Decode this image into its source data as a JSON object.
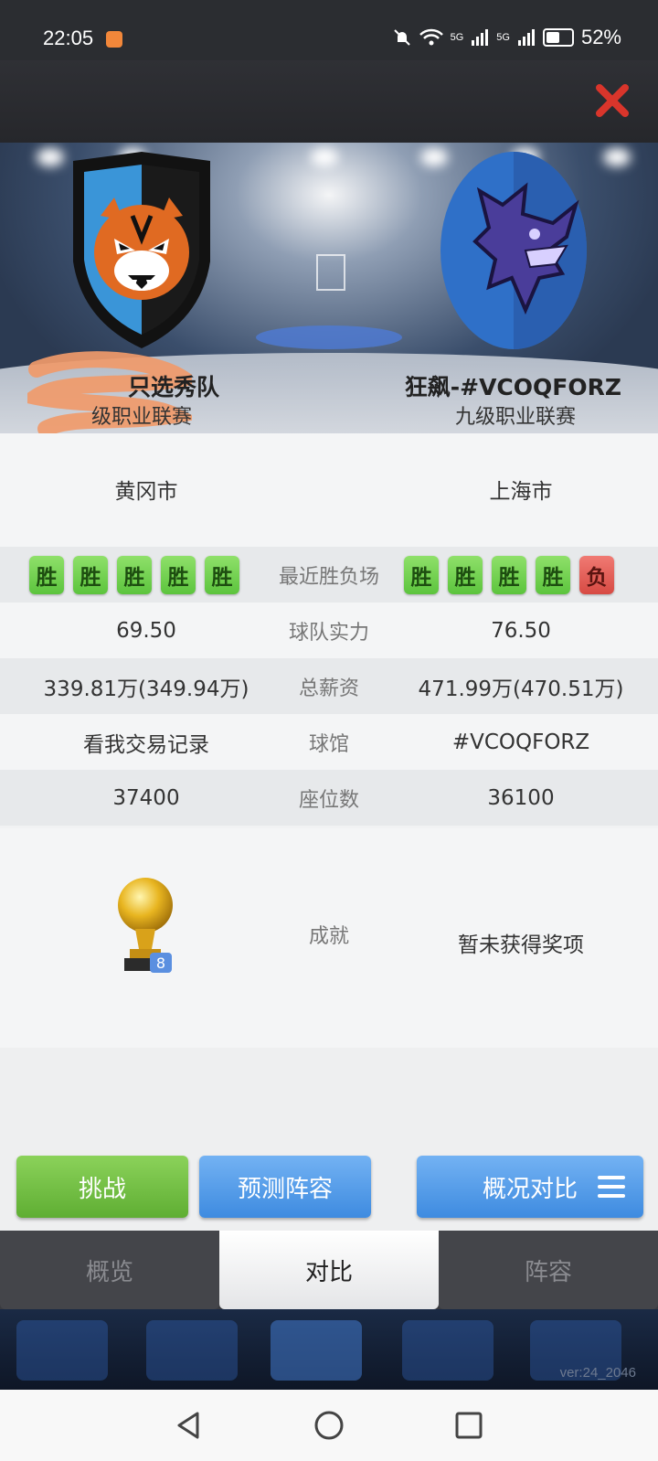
{
  "status_bar": {
    "time": "22:05",
    "net1": "5G",
    "net2": "5G",
    "battery": "52%"
  },
  "header": {
    "close_icon": "close-x-icon",
    "accent": "#d9352b"
  },
  "teams": {
    "left": {
      "name": "只选秀队",
      "league": "级职业联赛",
      "city": "黄冈市",
      "logo": "tiger-shield-logo"
    },
    "right": {
      "name": "狂飙-#VCOQFORZ",
      "league": "九级职业联赛",
      "city": "上海市",
      "logo": "dragon-oval-logo"
    }
  },
  "stats": {
    "recent": {
      "label": "最近胜负场",
      "left": [
        "胜",
        "胜",
        "胜",
        "胜",
        "胜"
      ],
      "right": [
        "胜",
        "胜",
        "胜",
        "胜",
        "负"
      ]
    },
    "strength": {
      "label": "球队实力",
      "left": "69.50",
      "right": "76.50"
    },
    "salary": {
      "label": "总薪资",
      "left": "339.81万(349.94万)",
      "right": "471.99万(470.51万)"
    },
    "arena": {
      "label": "球馆",
      "left": "看我交易记录",
      "right": "#VCOQFORZ"
    },
    "seats": {
      "label": "座位数",
      "left": "37400",
      "right": "36100"
    },
    "achievements": {
      "label": "成就",
      "left_trophy_count": "8",
      "right": "暂未获得奖项"
    }
  },
  "actions": {
    "challenge": "挑战",
    "predict": "预测阵容",
    "compare": "概况对比"
  },
  "tabs": [
    {
      "label": "概览"
    },
    {
      "label": "对比"
    },
    {
      "label": "阵容"
    }
  ],
  "active_tab": "对比",
  "footer": {
    "version": "ver:24_2046"
  }
}
